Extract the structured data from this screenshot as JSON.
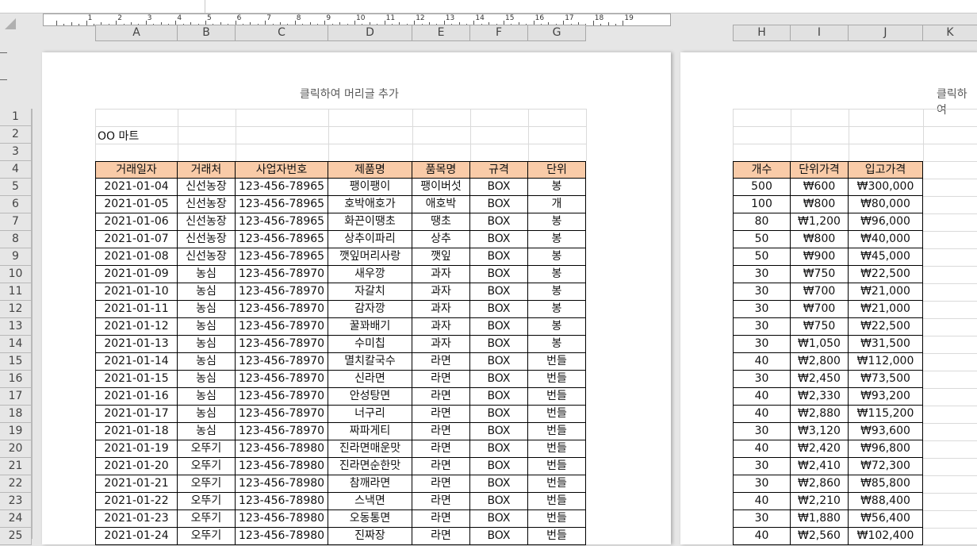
{
  "header_placeholder": "클릭하여 머리글 추가",
  "header_placeholder_cut": "클릭하여",
  "ruler_numbers": [
    "1",
    "2",
    "3",
    "4",
    "5",
    "6",
    "7",
    "8",
    "9",
    "10",
    "11",
    "12",
    "13",
    "14",
    "15",
    "16",
    "17",
    "18",
    "19"
  ],
  "columns_left": [
    "A",
    "B",
    "C",
    "D",
    "E",
    "F",
    "G"
  ],
  "columns_right": [
    "H",
    "I",
    "J",
    "K"
  ],
  "rows": [
    "1",
    "2",
    "3",
    "4",
    "5",
    "6",
    "7",
    "8",
    "9",
    "10",
    "11",
    "12",
    "13",
    "14",
    "15",
    "16",
    "17",
    "18",
    "19",
    "20",
    "21",
    "22",
    "23",
    "24",
    "25"
  ],
  "store_name": "OO 마트",
  "table_headers_left": [
    "거래일자",
    "거래처",
    "사업자번호",
    "제품명",
    "품목명",
    "규격",
    "단위"
  ],
  "table_headers_right": [
    "개수",
    "단위가격",
    "입고가격"
  ],
  "table_rows": [
    [
      "2021-01-04",
      "신선농장",
      "123-456-78965",
      "팽이팽이",
      "팽이버섯",
      "BOX",
      "봉",
      "500",
      "₩600",
      "₩300,000"
    ],
    [
      "2021-01-05",
      "신선농장",
      "123-456-78965",
      "호박애호가",
      "애호박",
      "BOX",
      "개",
      "100",
      "₩800",
      "₩80,000"
    ],
    [
      "2021-01-06",
      "신선농장",
      "123-456-78965",
      "화끈이땡초",
      "땡초",
      "BOX",
      "봉",
      "80",
      "₩1,200",
      "₩96,000"
    ],
    [
      "2021-01-07",
      "신선농장",
      "123-456-78965",
      "상추이파리",
      "상추",
      "BOX",
      "봉",
      "50",
      "₩800",
      "₩40,000"
    ],
    [
      "2021-01-08",
      "신선농장",
      "123-456-78965",
      "깻잎머리사랑",
      "깻잎",
      "BOX",
      "봉",
      "50",
      "₩900",
      "₩45,000"
    ],
    [
      "2021-01-09",
      "농심",
      "123-456-78970",
      "새우깡",
      "과자",
      "BOX",
      "봉",
      "30",
      "₩750",
      "₩22,500"
    ],
    [
      "2021-01-10",
      "농심",
      "123-456-78970",
      "자갈치",
      "과자",
      "BOX",
      "봉",
      "30",
      "₩700",
      "₩21,000"
    ],
    [
      "2021-01-11",
      "농심",
      "123-456-78970",
      "감자깡",
      "과자",
      "BOX",
      "봉",
      "30",
      "₩700",
      "₩21,000"
    ],
    [
      "2021-01-12",
      "농심",
      "123-456-78970",
      "꿀꽈배기",
      "과자",
      "BOX",
      "봉",
      "30",
      "₩750",
      "₩22,500"
    ],
    [
      "2021-01-13",
      "농심",
      "123-456-78970",
      "수미칩",
      "과자",
      "BOX",
      "봉",
      "30",
      "₩1,050",
      "₩31,500"
    ],
    [
      "2021-01-14",
      "농심",
      "123-456-78970",
      "멸치칼국수",
      "라면",
      "BOX",
      "번들",
      "40",
      "₩2,800",
      "₩112,000"
    ],
    [
      "2021-01-15",
      "농심",
      "123-456-78970",
      "신라면",
      "라면",
      "BOX",
      "번들",
      "30",
      "₩2,450",
      "₩73,500"
    ],
    [
      "2021-01-16",
      "농심",
      "123-456-78970",
      "안성탕면",
      "라면",
      "BOX",
      "번들",
      "40",
      "₩2,330",
      "₩93,200"
    ],
    [
      "2021-01-17",
      "농심",
      "123-456-78970",
      "너구리",
      "라면",
      "BOX",
      "번들",
      "40",
      "₩2,880",
      "₩115,200"
    ],
    [
      "2021-01-18",
      "농심",
      "123-456-78970",
      "짜파게티",
      "라면",
      "BOX",
      "번들",
      "30",
      "₩3,120",
      "₩93,600"
    ],
    [
      "2021-01-19",
      "오뚜기",
      "123-456-78980",
      "진라면매운맛",
      "라면",
      "BOX",
      "번들",
      "40",
      "₩2,420",
      "₩96,800"
    ],
    [
      "2021-01-20",
      "오뚜기",
      "123-456-78980",
      "진라면순한맛",
      "라면",
      "BOX",
      "번들",
      "30",
      "₩2,410",
      "₩72,300"
    ],
    [
      "2021-01-21",
      "오뚜기",
      "123-456-78980",
      "참깨라면",
      "라면",
      "BOX",
      "번들",
      "30",
      "₩2,860",
      "₩85,800"
    ],
    [
      "2021-01-22",
      "오뚜기",
      "123-456-78980",
      "스낵면",
      "라면",
      "BOX",
      "번들",
      "40",
      "₩2,210",
      "₩88,400"
    ],
    [
      "2021-01-23",
      "오뚜기",
      "123-456-78980",
      "오동통면",
      "라면",
      "BOX",
      "번들",
      "30",
      "₩1,880",
      "₩56,400"
    ],
    [
      "2021-01-24",
      "오뚜기",
      "123-456-78980",
      "진짜장",
      "라면",
      "BOX",
      "번들",
      "40",
      "₩2,560",
      "₩102,400"
    ]
  ],
  "colors": {
    "header_fill": "#f9cba8",
    "grid": "#dadada",
    "background": "#e6e6e6"
  }
}
